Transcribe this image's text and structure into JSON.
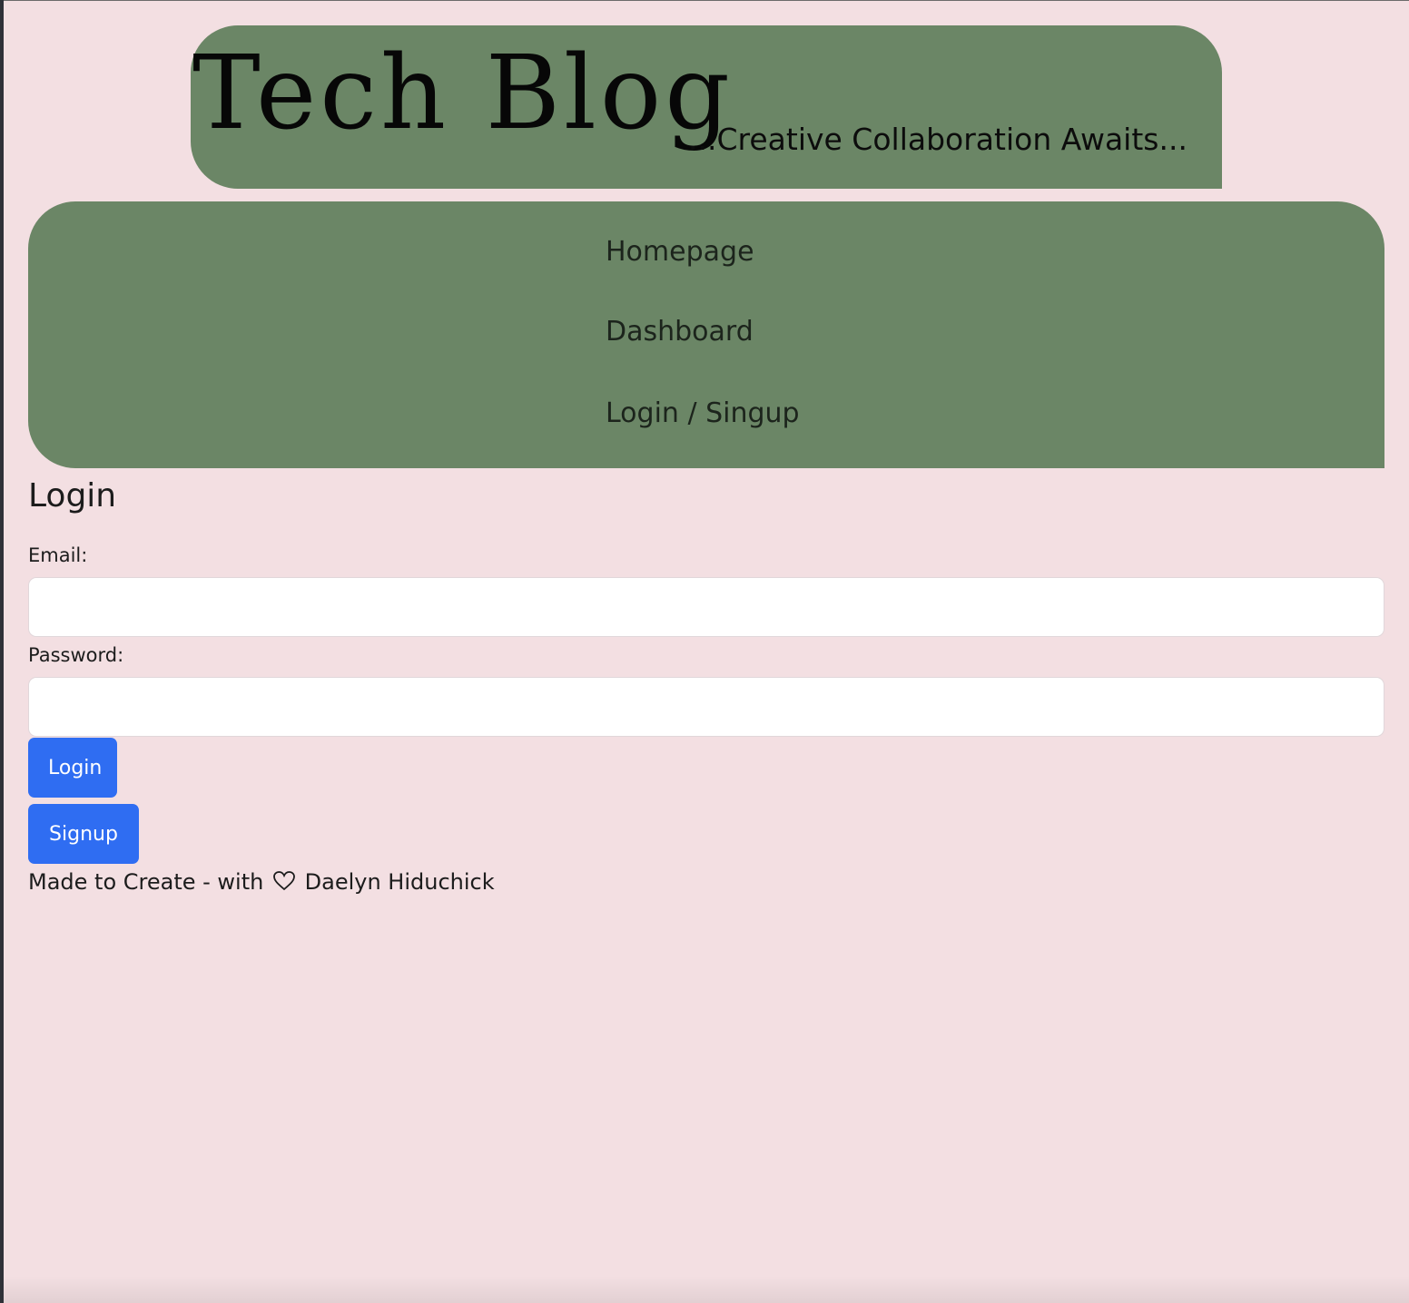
{
  "header": {
    "title": "Tech Blog",
    "tagline": "...Creative Collaboration Awaits..."
  },
  "nav": {
    "items": [
      {
        "label": "Homepage"
      },
      {
        "label": "Dashboard"
      },
      {
        "label": "Login / Singup"
      }
    ]
  },
  "login": {
    "heading": "Login",
    "email_label": "Email:",
    "email_value": "",
    "password_label": "Password:",
    "password_value": "",
    "login_button": "Login",
    "signup_button": "Signup"
  },
  "footer": {
    "text_before": "Made to Create - with",
    "heart_icon": "heart-outline-icon",
    "text_after": "Daelyn Hiduchick"
  },
  "colors": {
    "page_background": "#f3dfe2",
    "panel_green": "#6b8666",
    "button_blue": "#2f6df2",
    "input_background": "#ffffff"
  }
}
